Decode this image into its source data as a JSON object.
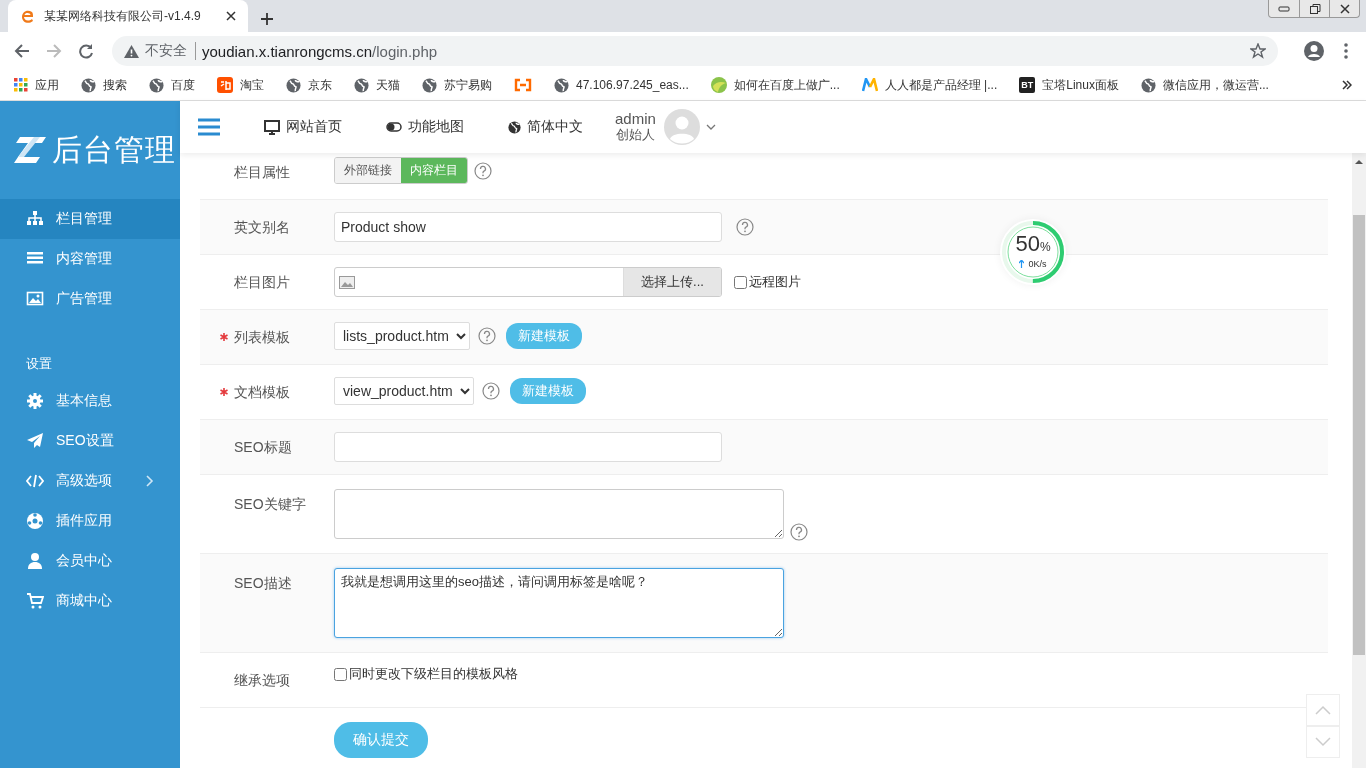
{
  "browser": {
    "tab": {
      "title": "某某网络科技有限公司-v1.4.9"
    },
    "address": {
      "warning": "不安全",
      "host": "youdian.x.tianrongcms.cn",
      "path": "/login.php"
    },
    "bookmarks": [
      {
        "kind": "apps",
        "label": "应用"
      },
      {
        "kind": "globe",
        "label": "搜索"
      },
      {
        "kind": "globe",
        "label": "百度"
      },
      {
        "kind": "shop",
        "label": "淘宝"
      },
      {
        "kind": "globe",
        "label": "京东"
      },
      {
        "kind": "globe",
        "label": "天猫"
      },
      {
        "kind": "globe",
        "label": "苏宁易购"
      },
      {
        "kind": "brackets"
      },
      {
        "kind": "globe",
        "label": "47.106.97.245_eas..."
      },
      {
        "kind": "leaf",
        "label": "如何在百度上做广..."
      },
      {
        "kind": "m",
        "label": "人人都是产品经理 |..."
      },
      {
        "kind": "bt",
        "badge": "BT",
        "label": "宝塔Linux面板"
      },
      {
        "kind": "globe",
        "label": "微信应用，微运营..."
      }
    ]
  },
  "sidebar": {
    "logo": "后台管理",
    "items": [
      {
        "kind": "sitemap",
        "label": "栏目管理",
        "selected": true
      },
      {
        "kind": "list",
        "label": "内容管理",
        "selected": false
      },
      {
        "kind": "image",
        "label": "广告管理",
        "selected": false
      }
    ],
    "section": "设置",
    "settings": [
      {
        "kind": "gear",
        "label": "基本信息",
        "selected": false
      },
      {
        "kind": "plane",
        "label": "SEO设置",
        "selected": false
      },
      {
        "kind": "code",
        "label": "高级选项",
        "selected": false,
        "has_submenu": true
      },
      {
        "kind": "ball",
        "label": "插件应用",
        "selected": false
      },
      {
        "kind": "user",
        "label": "会员中心",
        "selected": false
      },
      {
        "kind": "cart",
        "label": "商城中心",
        "selected": false
      }
    ]
  },
  "header": {
    "links": [
      {
        "kind": "monitor",
        "label": "网站首页"
      },
      {
        "kind": "toggle",
        "label": "功能地图"
      },
      {
        "kind": "globe",
        "label": "简体中文"
      }
    ],
    "user": {
      "name": "admin",
      "role": "创始人"
    }
  },
  "form": {
    "rows": [
      {
        "kind": "toggle",
        "label": "栏目属性",
        "options": [
          {
            "label": "外部链接",
            "selected": false
          },
          {
            "label": "内容栏目",
            "selected": true
          }
        ],
        "help": true
      },
      {
        "kind": "text",
        "label": "英文别名",
        "value": "Product show",
        "help": true
      },
      {
        "kind": "image",
        "label": "栏目图片",
        "button": "选择上传...",
        "checkbox": {
          "label": "远程图片",
          "checked": false
        }
      },
      {
        "kind": "select",
        "label": "列表模板",
        "required": true,
        "value": "lists_product.htm",
        "help": true,
        "button": "新建模板"
      },
      {
        "kind": "select",
        "label": "文档模板",
        "required": true,
        "value": "view_product.htm",
        "help": true,
        "button": "新建模板"
      },
      {
        "kind": "text",
        "label": "SEO标题"
      },
      {
        "kind": "textarea",
        "label": "SEO关键字",
        "help": true
      },
      {
        "kind": "textarea",
        "label": "SEO描述",
        "value": "我就是想调用这里的seo描述，请问调用标签是啥呢？",
        "focused": true
      },
      {
        "kind": "checkbox",
        "label": "继承选项",
        "checkbox": {
          "label": "同时更改下级栏目的模板风格",
          "checked": false
        }
      }
    ],
    "submit": "确认提交"
  },
  "speed_widget": {
    "percent": "50",
    "unit": "%",
    "speed": "0K/s",
    "level": 0.5
  }
}
